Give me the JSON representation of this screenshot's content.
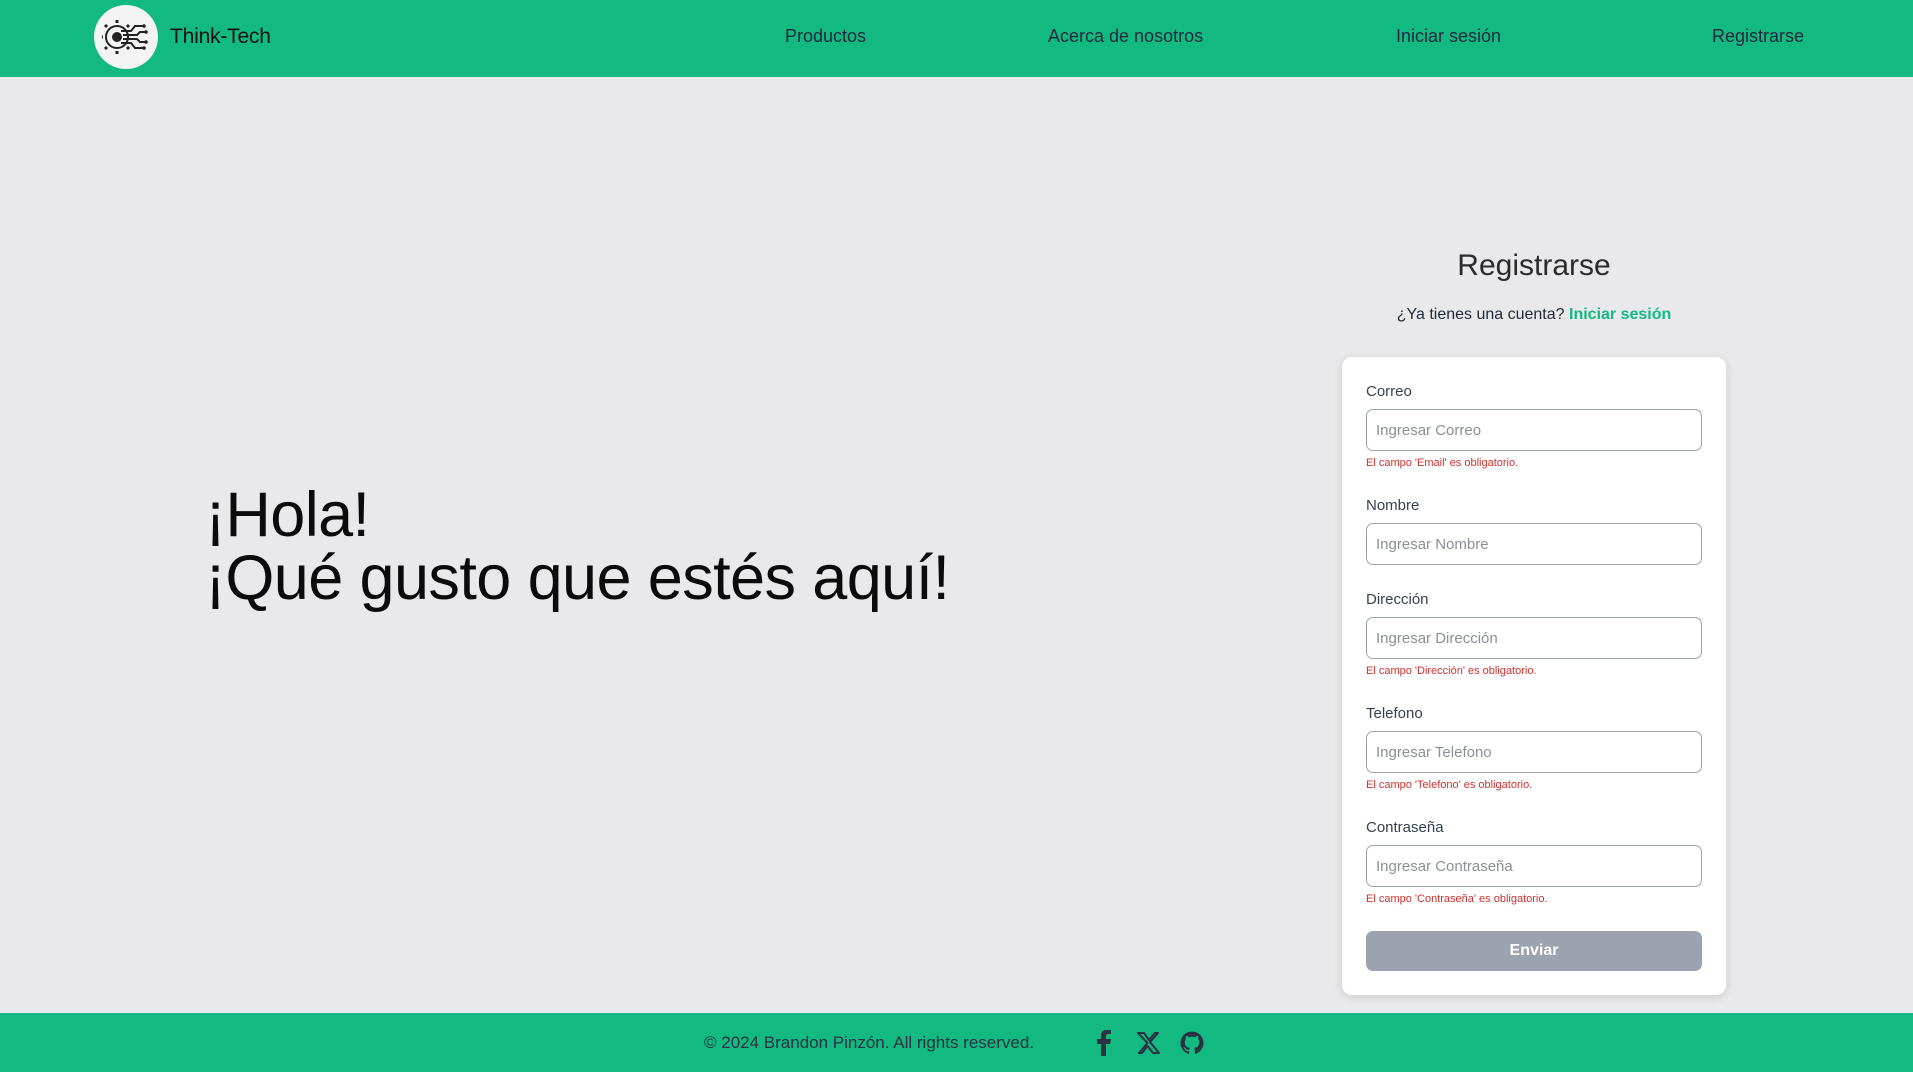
{
  "header": {
    "brand": "Think-Tech",
    "nav": [
      "Productos",
      "Acerca de nosotros",
      "Iniciar sesión",
      "Registrarse"
    ]
  },
  "hero": {
    "line1": "¡Hola!",
    "line2": "¡Qué gusto que estés aquí!"
  },
  "form": {
    "title": "Registrarse",
    "have_account": "¿Ya tienes una cuenta?",
    "login_link": "Iniciar sesión",
    "fields": [
      {
        "label": "Correo",
        "placeholder": "Ingresar Correo",
        "value": "",
        "error": "El campo 'Email' es obligatorio."
      },
      {
        "label": "Nombre",
        "placeholder": "Ingresar Nombre",
        "value": "",
        "error": ""
      },
      {
        "label": "Dirección",
        "placeholder": "Ingresar Dirección",
        "value": "",
        "error": "El campo 'Dirección' es obligatorio."
      },
      {
        "label": "Telefono",
        "placeholder": "Ingresar Telefono",
        "value": "",
        "error": "El campo 'Telefono' es obligatorio."
      },
      {
        "label": "Contraseña",
        "placeholder": "Ingresar Contraseña",
        "value": "",
        "error": "El campo 'Contraseña' es obligatorio."
      }
    ],
    "submit": "Enviar"
  },
  "footer": {
    "copyright": "© 2024 Brandon Pinzón. All rights reserved.",
    "social_icons": [
      "facebook-icon",
      "x-twitter-icon",
      "github-icon"
    ]
  },
  "colors": {
    "primary": "#12b981",
    "background": "#e9e9eb",
    "error": "#d0312d",
    "button_disabled": "#9ca3af"
  }
}
